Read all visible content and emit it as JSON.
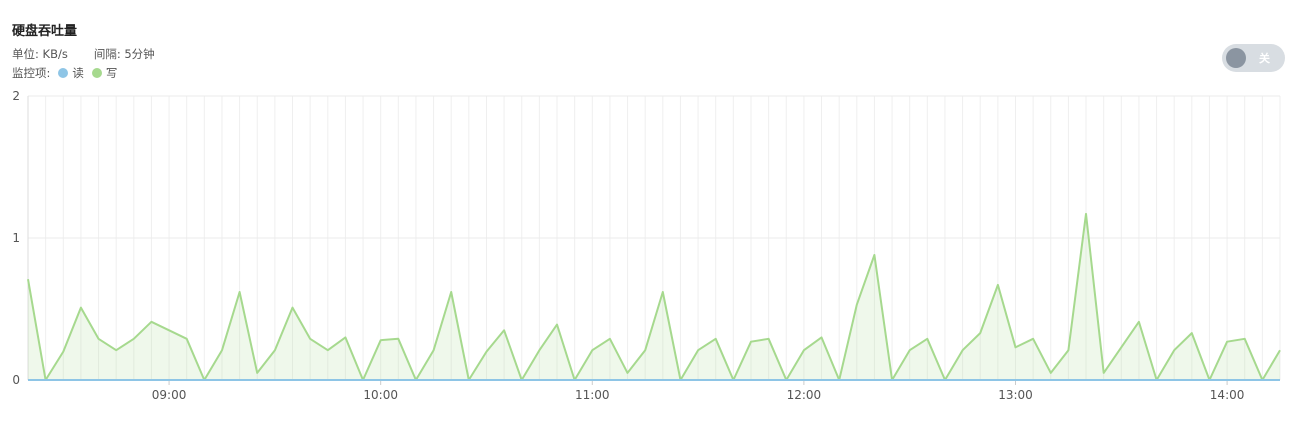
{
  "header": {
    "title": "硬盘吞吐量",
    "unit_text": "单位: KB/s",
    "interval_text": "间隔: 5分钟",
    "legend_label": "监控项:"
  },
  "toggle": {
    "label": "关"
  },
  "legend": [
    {
      "name": "读",
      "color": "#8ec5e6"
    },
    {
      "name": "写",
      "color": "#a6d98e"
    }
  ],
  "chart_data": {
    "type": "area",
    "ylim": [
      0,
      2
    ],
    "yticks": [
      "0",
      "1",
      "2"
    ],
    "xticks": [
      "09:00",
      "10:00",
      "11:00",
      "12:00",
      "13:00",
      "14:00"
    ],
    "x_start": "08:20",
    "x_end": "14:15",
    "series": [
      {
        "name": "写",
        "color": "#a6d98e",
        "values": [
          0.71,
          0.0,
          0.2,
          0.51,
          0.29,
          0.21,
          0.29,
          0.41,
          0.35,
          0.29,
          0.0,
          0.21,
          0.62,
          0.05,
          0.21,
          0.51,
          0.29,
          0.21,
          0.3,
          0.0,
          0.28,
          0.29,
          0.0,
          0.21,
          0.62,
          0.0,
          0.2,
          0.35,
          0.0,
          0.21,
          0.39,
          0.0,
          0.21,
          0.29,
          0.05,
          0.21,
          0.62,
          0.0,
          0.21,
          0.29,
          0.0,
          0.27,
          0.29,
          0.0,
          0.21,
          0.3,
          0.0,
          0.53,
          0.88,
          0.0,
          0.21,
          0.29,
          0.0,
          0.21,
          0.33,
          0.67,
          0.23,
          0.29,
          0.05,
          0.21,
          1.17,
          0.05,
          0.23,
          0.41,
          0.0,
          0.21,
          0.33,
          0.0,
          0.27,
          0.29,
          0.0,
          0.21
        ]
      },
      {
        "name": "读",
        "color": "#8ec5e6",
        "values": [
          0,
          0,
          0,
          0,
          0,
          0,
          0,
          0,
          0,
          0,
          0,
          0,
          0,
          0,
          0,
          0,
          0,
          0,
          0,
          0,
          0,
          0,
          0,
          0,
          0,
          0,
          0,
          0,
          0,
          0,
          0,
          0,
          0,
          0,
          0,
          0,
          0,
          0,
          0,
          0,
          0,
          0,
          0,
          0,
          0,
          0,
          0,
          0,
          0,
          0,
          0,
          0,
          0,
          0,
          0,
          0,
          0,
          0,
          0,
          0,
          0,
          0,
          0,
          0,
          0,
          0,
          0,
          0,
          0,
          0,
          0,
          0
        ]
      }
    ]
  }
}
